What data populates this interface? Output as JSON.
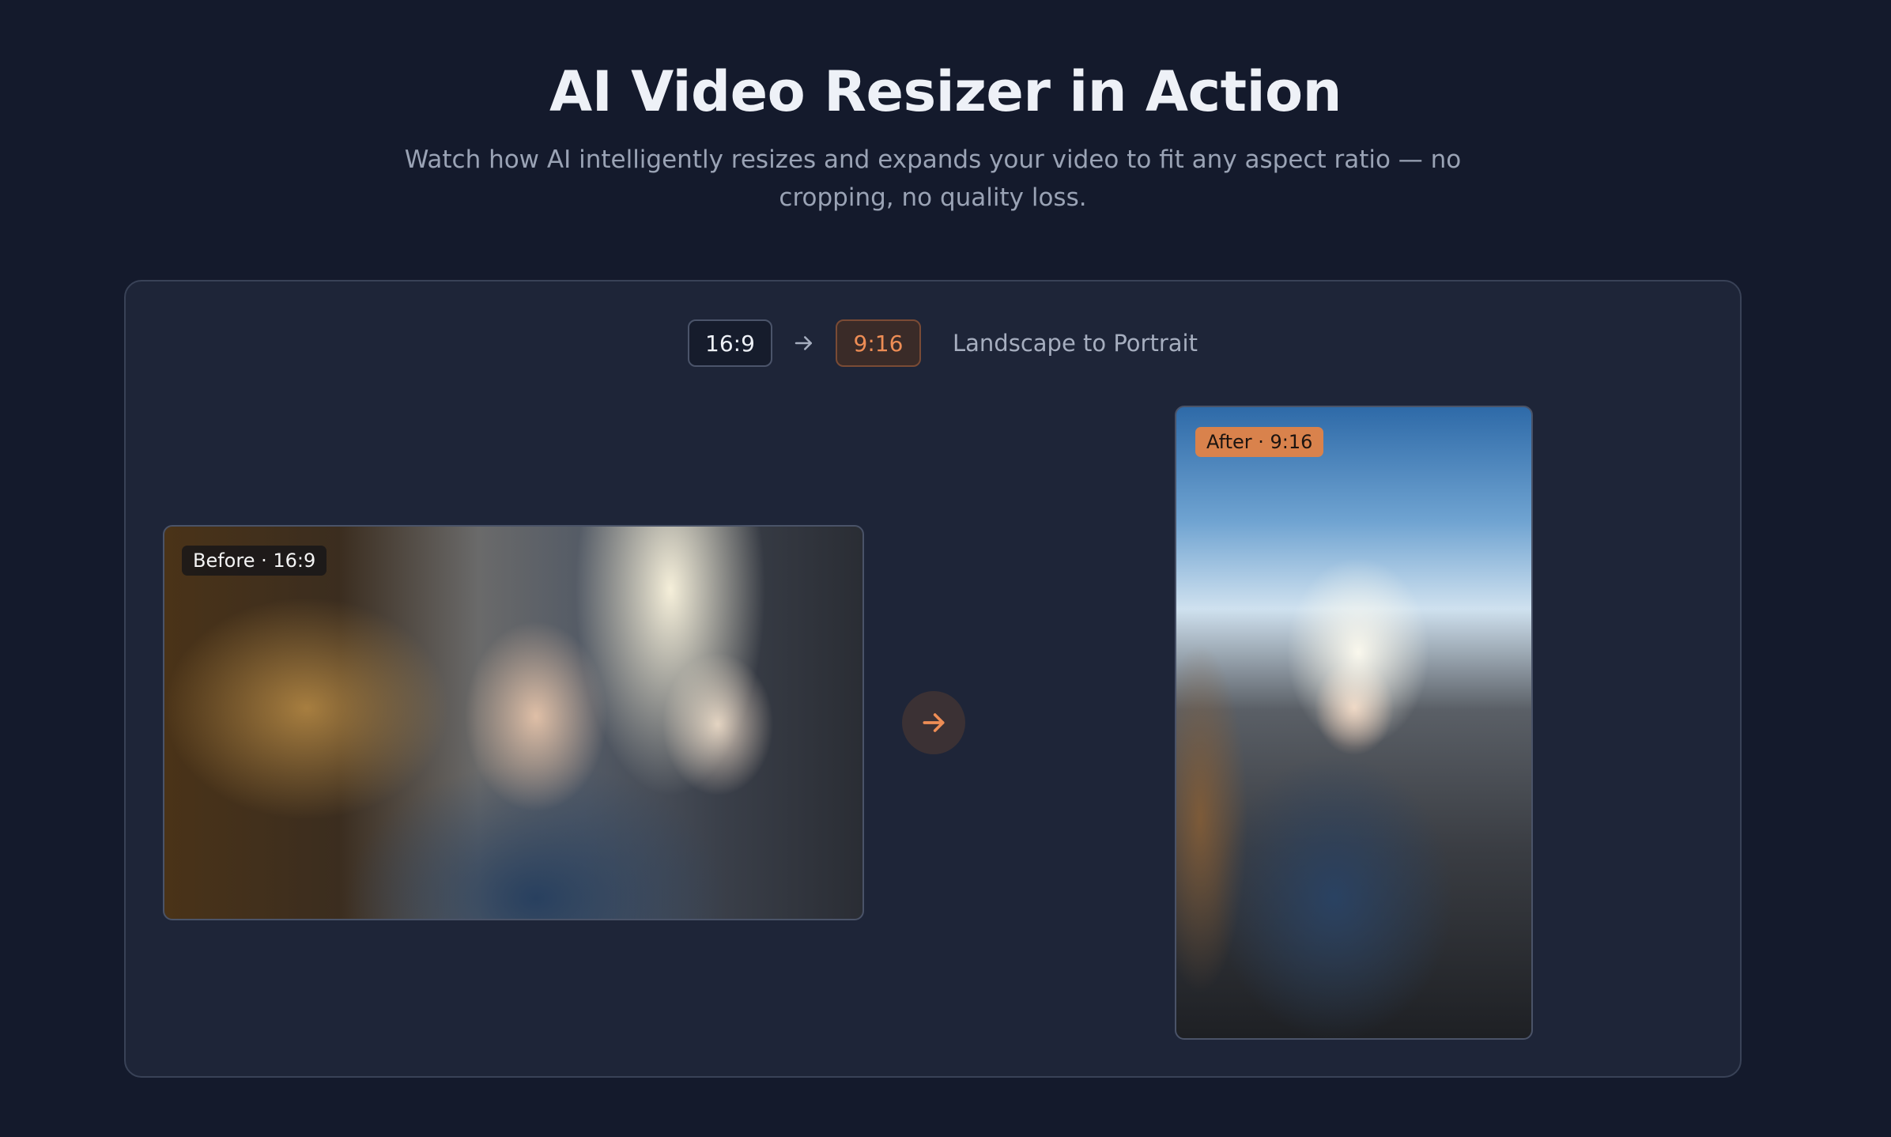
{
  "header": {
    "title": "AI Video Resizer in Action",
    "subtitle": "Watch how AI intelligently resizes and expands your video to fit any aspect ratio — no cropping, no quality loss."
  },
  "ratio_selector": {
    "from": "16:9",
    "to": "9:16",
    "mode_label": "Landscape to Portrait",
    "arrow_icon": "arrow-right-icon"
  },
  "preview": {
    "before_label": "Before · 16:9",
    "after_label": "After · 9:16",
    "transition_icon": "arrow-right-icon"
  },
  "colors": {
    "background": "#141a2c",
    "panel": "#1e2538",
    "accent": "#ee8d55",
    "after_badge": "#d9824c"
  }
}
